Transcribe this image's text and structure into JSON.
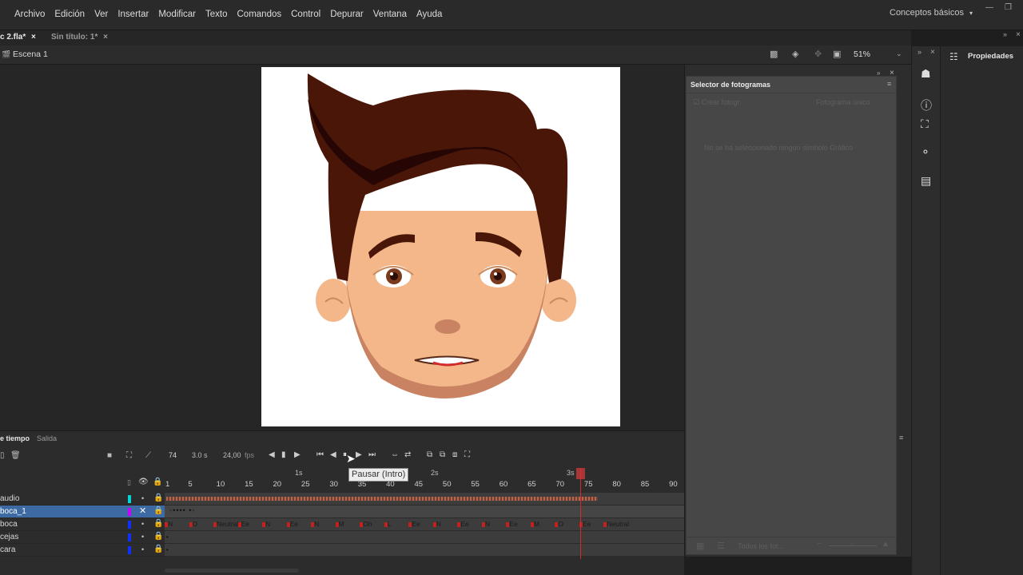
{
  "menubar": {
    "items": [
      "Archivo",
      "Edición",
      "Ver",
      "Insertar",
      "Modificar",
      "Texto",
      "Comandos",
      "Control",
      "Depurar",
      "Ventana",
      "Ayuda"
    ],
    "workspace": "Conceptos básicos"
  },
  "doc_tabs": [
    {
      "label": "c 2.fla*"
    },
    {
      "label": "Sin título: 1*"
    }
  ],
  "scene": {
    "name": "Escena 1",
    "zoom": "51%"
  },
  "picker": {
    "title": "Selector de fotogramas",
    "create_keyframe": "Crear fotogr.",
    "frame_type": "Fotograma único",
    "empty_message": "No se ha seleccionado ningún símbolo Gráfico",
    "all_frames": "Todos los fot..."
  },
  "properties": {
    "title": "Propiedades"
  },
  "timeline": {
    "tabs": [
      "e tiempo",
      "Salida"
    ],
    "current_frame": "74",
    "time": "3.0 s",
    "fps": "24,00",
    "fps_unit": "fps",
    "tooltip": "Pausar (Intro)",
    "seconds_marks": [
      "1s",
      "2s",
      "3s"
    ],
    "ruler_numbers": [
      "1",
      "5",
      "10",
      "15",
      "20",
      "25",
      "30",
      "35",
      "40",
      "45",
      "50",
      "55",
      "60",
      "65",
      "70",
      "75",
      "80",
      "85",
      "90"
    ],
    "layers": [
      {
        "name": "audio",
        "color": "#00d4d4",
        "selected": false
      },
      {
        "name": "boca_1",
        "color": "#c800ff",
        "selected": true
      },
      {
        "name": "boca",
        "color": "#1030ff",
        "selected": false
      },
      {
        "name": "cejas",
        "color": "#1030ff",
        "selected": false
      },
      {
        "name": "cara",
        "color": "#1030ff",
        "selected": false
      }
    ],
    "boca_labels": [
      "N",
      "O",
      "Neutral",
      "Ee",
      "N",
      "Ee",
      "N",
      "M",
      "Oh",
      "L",
      "Ee",
      "N",
      "Ee",
      "N",
      "Ee",
      "M",
      "O",
      "Ee",
      "Neutral"
    ]
  },
  "colors": {
    "accent_selected": "#3d6aa3",
    "playhead": "#d42a2a",
    "hair": "#4a1608",
    "skin": "#f3b78a"
  }
}
